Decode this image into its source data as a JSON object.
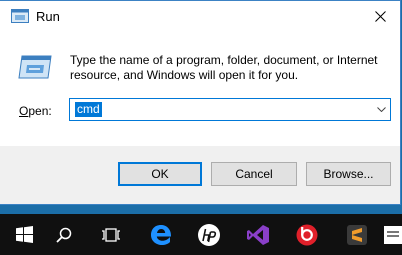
{
  "window": {
    "title": "Run",
    "description": "Type the name of a program, folder, document, or Internet resource, and Windows will open it for you."
  },
  "open": {
    "label_prefix": "",
    "label_underlined": "O",
    "label_rest": "pen:",
    "value": "cmd"
  },
  "buttons": {
    "ok": "OK",
    "cancel": "Cancel",
    "browse": "Browse..."
  },
  "taskbar": {
    "items": [
      "start-icon",
      "search-icon",
      "task-view-icon",
      "edge-icon",
      "hp-icon",
      "visual-studio-icon",
      "beats-icon",
      "sublime-text-icon"
    ]
  },
  "colors": {
    "accent": "#0078d7",
    "taskbar": "#101010",
    "desktop": "#1b6ea8"
  }
}
